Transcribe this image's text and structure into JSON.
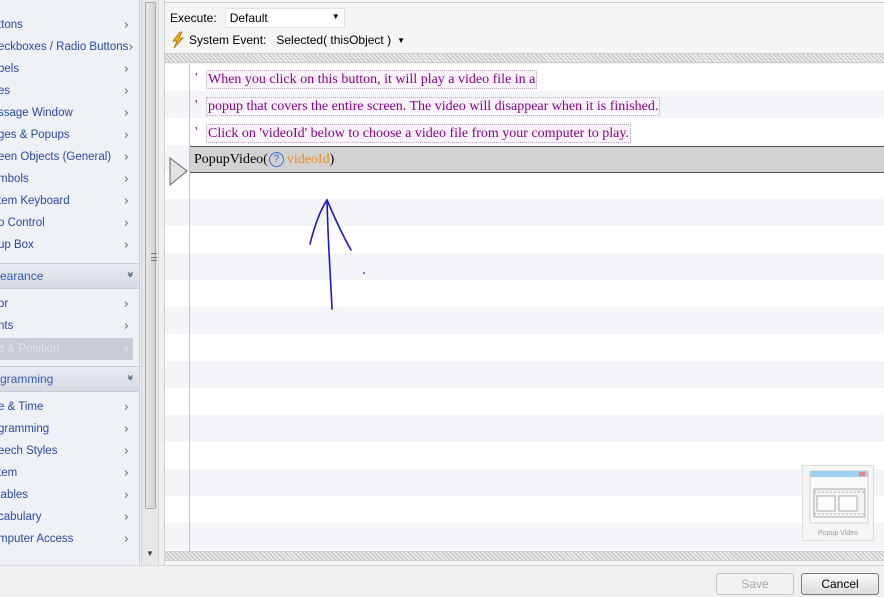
{
  "sidebar": {
    "top_items": [
      {
        "label": "ttons"
      },
      {
        "label": "eckboxes / Radio Buttons"
      },
      {
        "label": "bels"
      },
      {
        "label": "es"
      },
      {
        "label": "ssage Window"
      },
      {
        "label": "ges & Popups"
      },
      {
        "label": "een Objects (General)"
      },
      {
        "label": "mbols"
      },
      {
        "label": "tem Keyboard"
      },
      {
        "label": "o Control"
      },
      {
        "label": "up Box"
      }
    ],
    "appearance_header": "earance",
    "appearance_items": [
      {
        "label": "or"
      },
      {
        "label": "nts"
      },
      {
        "label": "e & Position"
      }
    ],
    "programming_header": "gramming",
    "programming_items": [
      {
        "label": "e & Time"
      },
      {
        "label": "gramming"
      },
      {
        "label": "eech Styles"
      },
      {
        "label": "tem"
      },
      {
        "label": "iables"
      },
      {
        "label": "cabulary"
      },
      {
        "label": "mputer Access"
      }
    ]
  },
  "execute": {
    "label": "Execute:",
    "value": "Default"
  },
  "event": {
    "label": "System Event:",
    "value": "Selected( thisObject )"
  },
  "comments": [
    "When you click on this button, it will play a video file in a",
    "popup that covers the entire screen.  The video will disappear when it is finished.",
    "Click on 'videoId' below to choose a video file from your computer to play."
  ],
  "comment_mark": "'",
  "code": {
    "function": "PopupVideo(",
    "help": "?",
    "param": "videoId",
    "close": ")"
  },
  "thumbnail": {
    "caption": "Popup Video"
  },
  "footer": {
    "save": "Save",
    "cancel": "Cancel"
  },
  "colors": {
    "comment": "#8b008b",
    "param": "#f08a1c",
    "link": "#2a49a3",
    "ink": "#1a1ad0"
  }
}
